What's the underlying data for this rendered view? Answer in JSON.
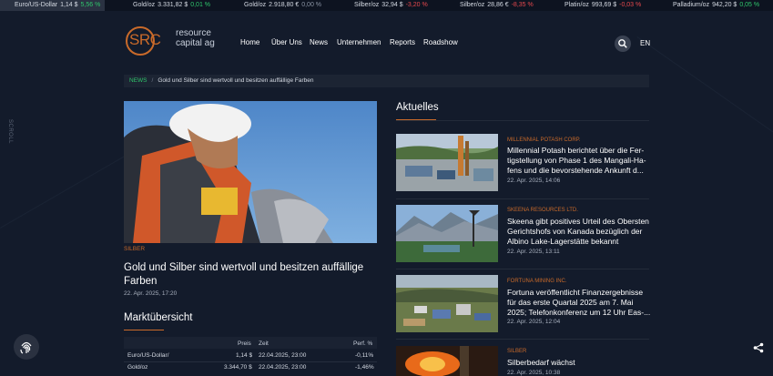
{
  "ticker": [
    {
      "name": "Euro/US-Dollar",
      "value": "1,14 $",
      "change": "5,56 %",
      "dir": "up"
    },
    {
      "name": "Gold/oz",
      "value": "3.331,82 $",
      "change": "0,01 %",
      "dir": "up"
    },
    {
      "name": "Gold/oz",
      "value": "2.918,80 €",
      "change": "0,00 %",
      "dir": "flat"
    },
    {
      "name": "Silber/oz",
      "value": "32,94 $",
      "change": "-3,20 %",
      "dir": "down"
    },
    {
      "name": "Silber/oz",
      "value": "28,86 €",
      "change": "-8,35 %",
      "dir": "down"
    },
    {
      "name": "Platin/oz",
      "value": "993,69 $",
      "change": "-0,03 %",
      "dir": "down"
    },
    {
      "name": "Palladium/oz",
      "value": "942,20 $",
      "change": "0,05 %",
      "dir": "up"
    }
  ],
  "logo": {
    "letters": "SRC",
    "line1": "resource",
    "line2": "capital ag"
  },
  "nav": [
    "Home",
    "Über Uns",
    "News",
    "Unternehmen",
    "Reports",
    "Roadshow"
  ],
  "lang": "EN",
  "breadcrumb": {
    "section": "NEWS",
    "separator": "/",
    "title": "Gold und Silber sind wertvoll und besitzen auffällige Farben"
  },
  "scroll_label": "SCROLL",
  "hero": {
    "category": "SILBER",
    "title": "Gold und Silber sind wertvoll und besitzen auffällige Farben",
    "date": "22. Apr. 2025, 17:20"
  },
  "market": {
    "title": "Marktübersicht",
    "headers": {
      "price": "Preis",
      "time": "Zeit",
      "perf": "Perf. %"
    },
    "rows": [
      {
        "name": "Euro/US-Dollar/",
        "price": "1,14 $",
        "time": "22.04.2025, 23:00",
        "perf": "-0,11%"
      },
      {
        "name": "Gold/oz",
        "price": "3.344,70 $",
        "time": "22.04.2025, 23:00",
        "perf": "-1,46%"
      }
    ]
  },
  "aktuelles": {
    "title": "Aktuelles",
    "items": [
      {
        "category": "MILLENNIAL POTASH CORP.",
        "headline": "Millennial Potash berichtet über die Fer-tigstellung von Phase 1 des Mangali-Ha-fens und die bevorstehende Ankunft d...",
        "date": "22. Apr. 2025, 14:06"
      },
      {
        "category": "SKEENA RESOURCES LTD.",
        "headline": "Skeena gibt positives Urteil des Obersten Gerichtshofs von Kanada bezüglich der Albino Lake-Lagerstätte bekannt",
        "date": "22. Apr. 2025, 13:11"
      },
      {
        "category": "FORTUNA MINING INC.",
        "headline": "Fortuna veröffentlicht Finanzergebnisse für das erste Quartal 2025 am 7. Mai 2025; Telefonkonferenz um 12 Uhr Eas-...",
        "date": "22. Apr. 2025, 12:04"
      },
      {
        "category": "SILBER",
        "headline": "Silberbedarf wächst",
        "date": "22. Apr. 2025, 10:38"
      }
    ]
  },
  "colors": {
    "accent": "#c96a2a",
    "up": "#2fc56b",
    "down": "#e5484d",
    "background": "#131b2b"
  },
  "icons": {
    "search": "search-icon",
    "fingerprint": "fingerprint-icon",
    "share": "share-icon"
  }
}
